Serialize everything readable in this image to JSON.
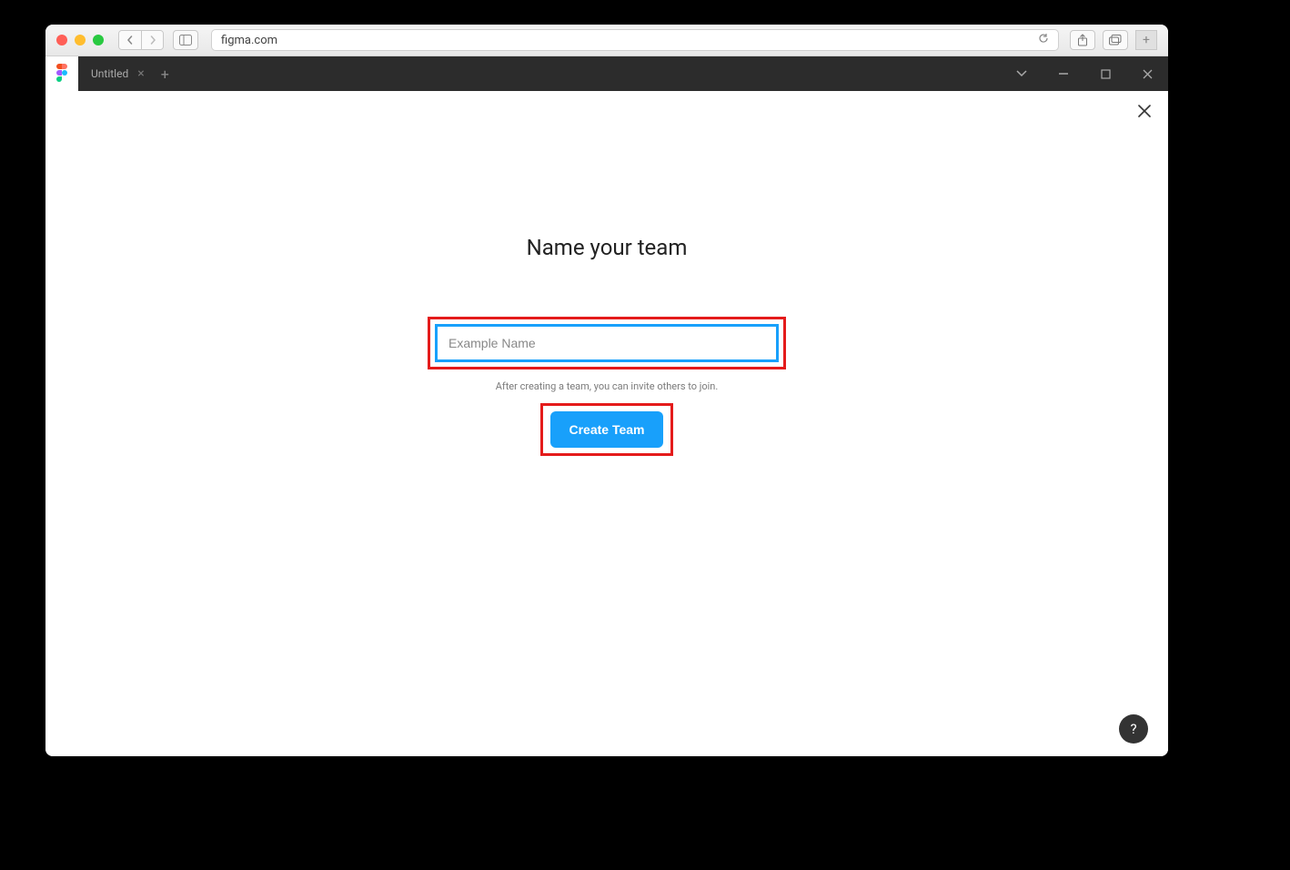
{
  "browser": {
    "url": "figma.com"
  },
  "figma_bar": {
    "tab_title": "Untitled"
  },
  "dialog": {
    "heading": "Name your team",
    "input_placeholder": "Example Name",
    "hint": "After creating a team, you can invite others to join.",
    "create_button": "Create Team"
  },
  "help": {
    "label": "?"
  },
  "colors": {
    "accent": "#18a0fb",
    "highlight": "#e41b1b"
  }
}
